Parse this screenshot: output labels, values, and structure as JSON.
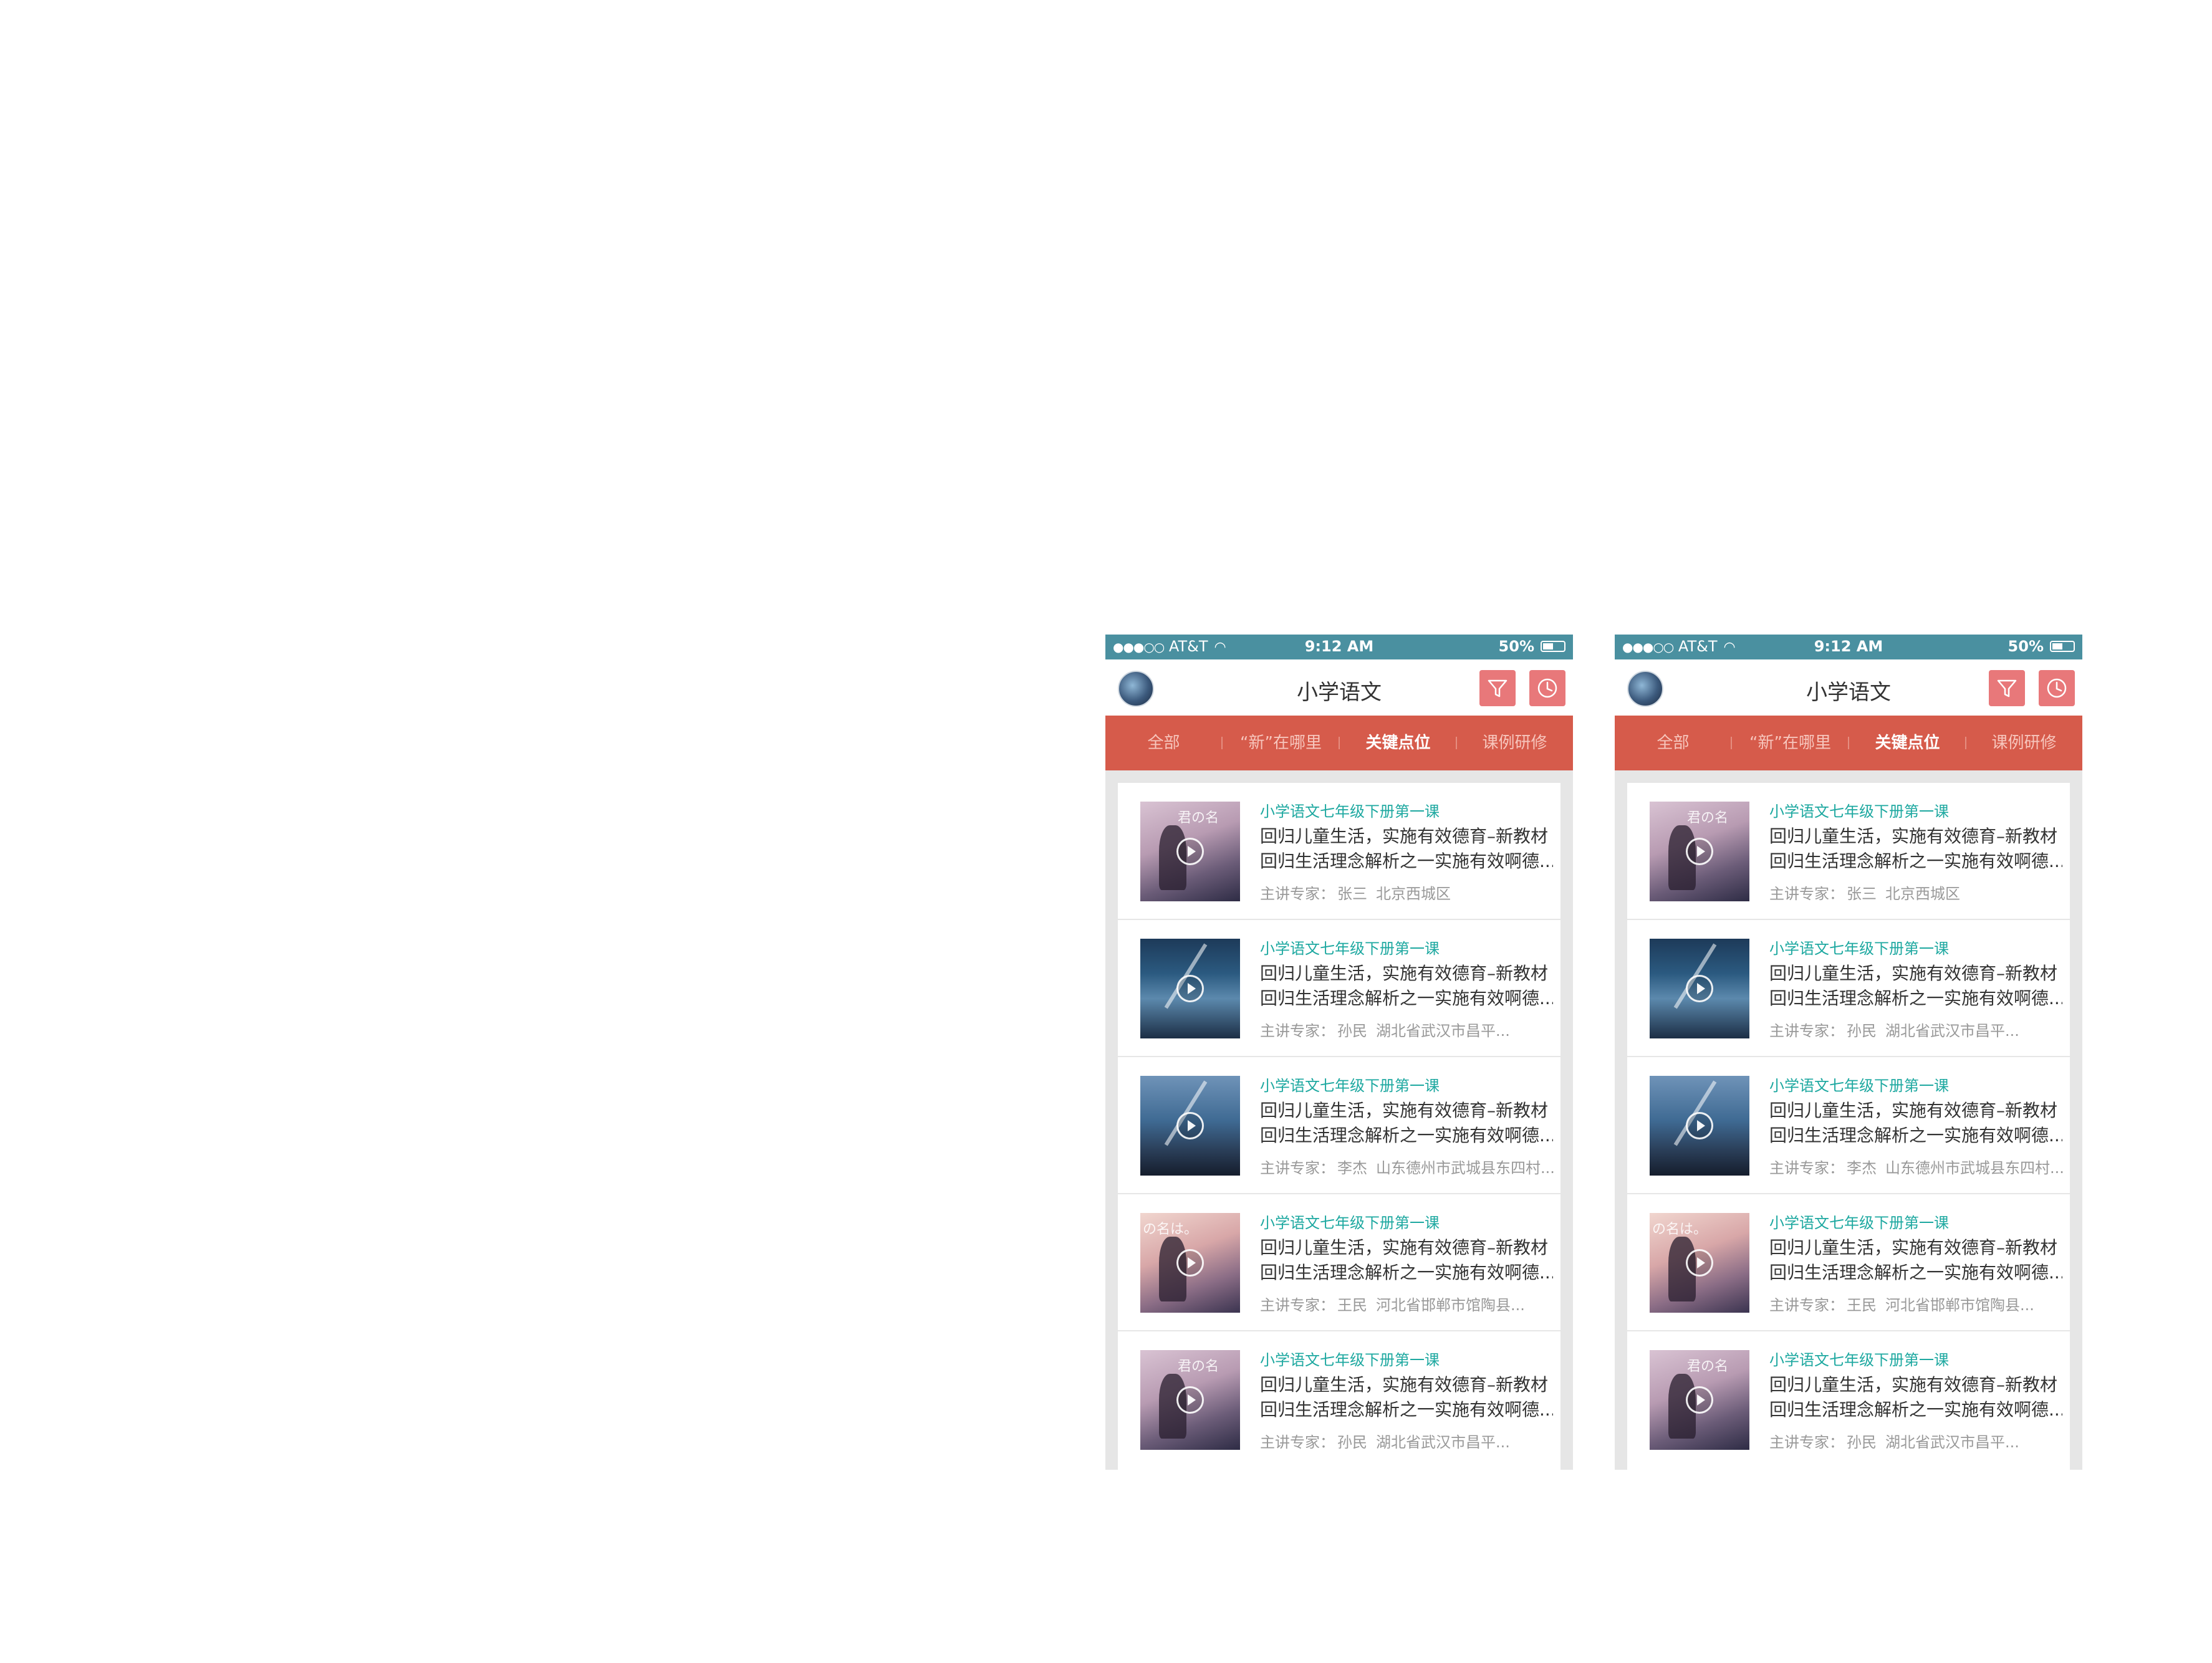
{
  "colors": {
    "status_bar": "#4a90a0",
    "tab_bar": "#d65b4b",
    "accent_teal": "#1da8a0",
    "text_main": "#333333",
    "text_meta": "#999999",
    "background": "#e6e6e6",
    "icon_button": "#e8787a"
  },
  "status": {
    "carrier": "AT&T",
    "signal": "●●●○○",
    "time": "9:12 AM",
    "battery": "50%"
  },
  "nav": {
    "title": "小学语文",
    "filter_icon": "filter-icon",
    "history_icon": "clock-icon"
  },
  "tabs": [
    {
      "label": "全部"
    },
    {
      "label": "“新”在哪里"
    },
    {
      "label": "关键点位"
    },
    {
      "label": "课例研修"
    }
  ],
  "active_tab": 2,
  "courses": [
    {
      "title": "小学语文七年级下册第一课",
      "desc_line1": "回归儿童生活，实施有效德育–新教材",
      "desc_line2": "回归生活理念解析之一实施有效啊德...",
      "meta_label": "主讲专家：",
      "expert": "张三",
      "location": "北京西城区",
      "thumb_text": "君の名"
    },
    {
      "title": "小学语文七年级下册第一课",
      "desc_line1": "回归儿童生活，实施有效德育–新教材",
      "desc_line2": "回归生活理念解析之一实施有效啊德...",
      "meta_label": "主讲专家：",
      "expert": "孙民",
      "location": "湖北省武汉市昌平...",
      "thumb_text": ""
    },
    {
      "title": "小学语文七年级下册第一课",
      "desc_line1": "回归儿童生活，实施有效德育–新教材",
      "desc_line2": "回归生活理念解析之一实施有效啊德...",
      "meta_label": "主讲专家：",
      "expert": "李杰",
      "location": "山东德州市武城县东四村...",
      "thumb_text": ""
    },
    {
      "title": "小学语文七年级下册第一课",
      "desc_line1": "回归儿童生活，实施有效德育–新教材",
      "desc_line2": "回归生活理念解析之一实施有效啊德...",
      "meta_label": "主讲专家：",
      "expert": "王民",
      "location": "河北省邯郸市馆陶县...",
      "thumb_text": "の名は。"
    },
    {
      "title": "小学语文七年级下册第一课",
      "desc_line1": "回归儿童生活，实施有效德育–新教材",
      "desc_line2": "回归生活理念解析之一实施有效啊德...",
      "meta_label": "主讲专家：",
      "expert": "孙民",
      "location": "湖北省武汉市昌平...",
      "thumb_text": "君の名"
    }
  ]
}
